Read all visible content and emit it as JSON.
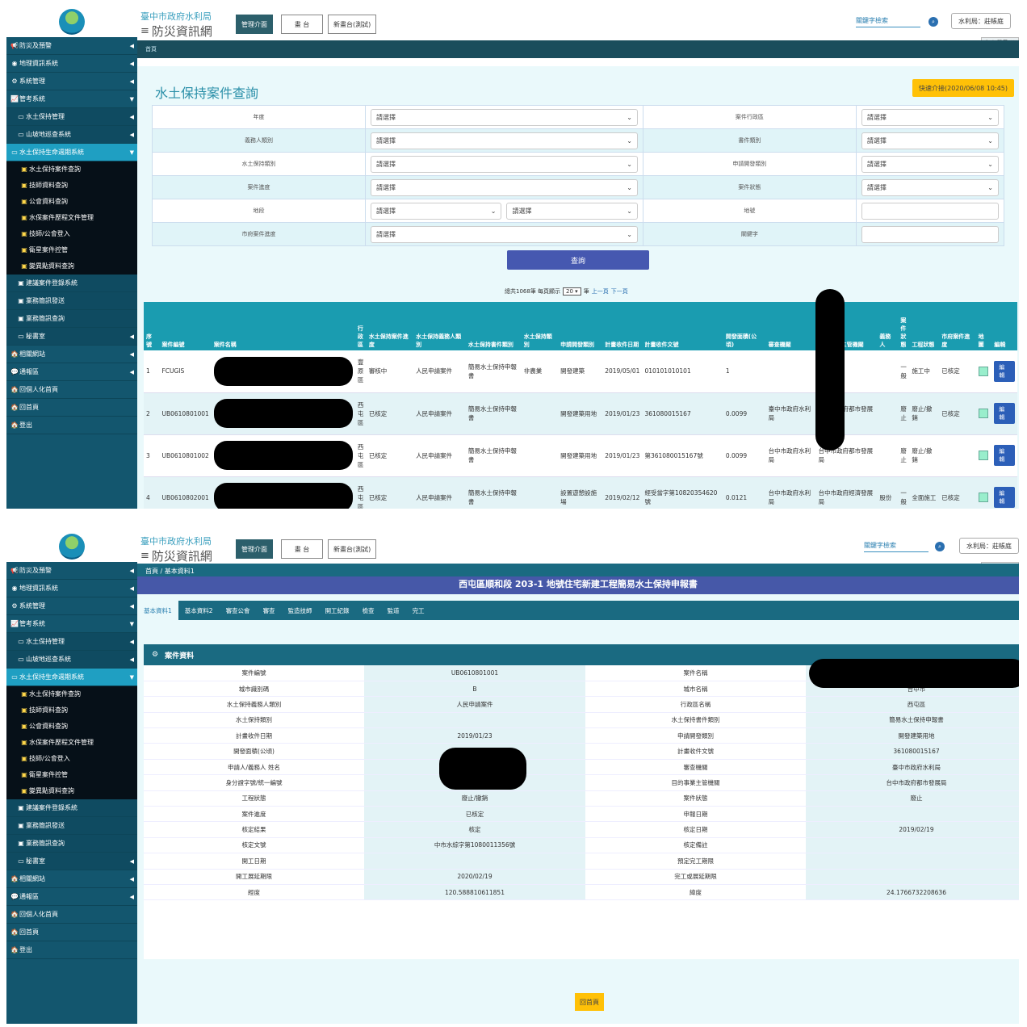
{
  "brand": {
    "agency": "臺中市政府水利局",
    "system": "防災資訊網"
  },
  "header": {
    "manage": "管理介面",
    "wall": "畫 台",
    "wall_test": "新畫台(測試)",
    "keyword": "關鍵字檢索",
    "user": "水利局：莊帳庭",
    "fav": "加入最愛 ♡"
  },
  "sidebar1": [
    {
      "icon": "📢",
      "label": "防災及預警",
      "arrow": "◀",
      "type": "plain"
    },
    {
      "icon": "◉",
      "label": "地理資訊系統",
      "arrow": "◀",
      "type": "plain"
    },
    {
      "icon": "⚙",
      "label": "系統管理",
      "arrow": "◀",
      "type": "plain"
    },
    {
      "icon": "📈",
      "label": "管考系統",
      "arrow": "▼",
      "type": "plain"
    },
    {
      "icon": "▭",
      "label": "水土保持管理",
      "arrow": "◀",
      "type": "sub"
    },
    {
      "icon": "▭",
      "label": "山坡地巡查系統",
      "arrow": "◀",
      "type": "sub"
    },
    {
      "icon": "▭",
      "label": "水土保持生命週期系統",
      "arrow": "▼",
      "type": "act"
    },
    {
      "icon": "▣",
      "label": "水土保持案件查詢",
      "arrow": "",
      "type": "leaf"
    },
    {
      "icon": "▣",
      "label": "技師資料查詢",
      "arrow": "",
      "type": "leaf"
    },
    {
      "icon": "▣",
      "label": "公會資料查詢",
      "arrow": "",
      "type": "leaf"
    },
    {
      "icon": "▣",
      "label": "水保案件歷程文件管理",
      "arrow": "",
      "type": "leaf"
    },
    {
      "icon": "▣",
      "label": "技師/公會登入",
      "arrow": "",
      "type": "leaf"
    },
    {
      "icon": "▣",
      "label": "衛星案件控管",
      "arrow": "",
      "type": "leaf"
    },
    {
      "icon": "▣",
      "label": "變異點資料查詢",
      "arrow": "",
      "type": "leaf"
    },
    {
      "icon": "▣",
      "label": "建議案件登錄系統",
      "arrow": "",
      "type": "sub"
    },
    {
      "icon": "▣",
      "label": "業務簡訊發送",
      "arrow": "",
      "type": "sub"
    },
    {
      "icon": "▣",
      "label": "業務簡訊查詢",
      "arrow": "",
      "type": "sub"
    },
    {
      "icon": "▭",
      "label": "秘書室",
      "arrow": "◀",
      "type": "sub"
    },
    {
      "icon": "🏠",
      "label": "相關網站",
      "arrow": "◀",
      "type": "plain"
    },
    {
      "icon": "💬",
      "label": "通報區",
      "arrow": "◀",
      "type": "plain"
    },
    {
      "icon": "🏠",
      "label": "回個人化首頁",
      "arrow": "",
      "type": "plain"
    },
    {
      "icon": "🏠",
      "label": "回首頁",
      "arrow": "",
      "type": "plain"
    },
    {
      "icon": "🏠",
      "label": "登出",
      "arrow": "",
      "type": "plain"
    }
  ],
  "screen1": {
    "breadcrumb": "首頁",
    "title": "水土保持案件查詢",
    "quick": "快速介接(2020/06/08 10:45)",
    "placeholder": "請選擇",
    "filters": [
      [
        "年度",
        "案件行政區"
      ],
      [
        "義務人類別",
        "書件類別"
      ],
      [
        "水土保持類別",
        "申請開發類別"
      ],
      [
        "案件進度",
        "案件狀態"
      ],
      [
        "地段",
        "地號"
      ],
      [
        "市府案件進度",
        "關鍵字"
      ]
    ],
    "query": "查詢",
    "pager": {
      "prefix": "總共1068筆 每頁顯示",
      "size": "20 ▾",
      "suffix": "筆",
      "prev": "上一頁",
      "next": "下一頁"
    },
    "columns": [
      "序號",
      "案件編號",
      "案件名稱",
      "行政區",
      "水土保持案件進度",
      "水土保持義務人類別",
      "水土保持書件類別",
      "水土保持類別",
      "申請開發類別",
      "計畫收件日期",
      "計畫收件文號",
      "開發面積(公頃)",
      "審查機關",
      "目的事業主管機關",
      "義務人",
      "案件狀態",
      "工程狀態",
      "市府案件進度",
      "地圖",
      "編輯"
    ],
    "rows": [
      [
        "1",
        "FCUGIS",
        "",
        "豐原區",
        "審核中",
        "人民申請案件",
        "簡易水土保持申報書",
        "非農業",
        "開發建築",
        "2019/05/01",
        "010101010101",
        "1",
        "",
        "",
        "",
        "一般",
        "施工中",
        "已核定",
        "",
        "編輯"
      ],
      [
        "2",
        "UB0610801001",
        "",
        "西屯區",
        "已核定",
        "人民申請案件",
        "簡易水土保持申報書",
        "",
        "開發建築用地",
        "2019/01/23",
        "361080015167",
        "0.0099",
        "臺中市政府水利局",
        "台中市政府都市發展局",
        "",
        "廢止",
        "廢止/撤銷",
        "已核定",
        "",
        "編輯"
      ],
      [
        "3",
        "UB0610801002",
        "",
        "西屯區",
        "已核定",
        "人民申請案件",
        "簡易水土保持申報書",
        "",
        "開發建築用地",
        "2019/01/23",
        "第361080015167號",
        "0.0099",
        "台中市政府水利局",
        "台中市政府都市發展局",
        "",
        "廢止",
        "廢止/撤銷",
        "",
        "",
        "編輯"
      ],
      [
        "4",
        "UB0610802001",
        "業",
        "西屯區",
        "已核定",
        "人民申請案件",
        "簡易水土保持申報書",
        "",
        "設置遊憩設施場",
        "2019/02/12",
        "經受當字第10820354620號",
        "0.0121",
        "台中市政府水利局",
        "台中市政府經濟發展局",
        "股份",
        "一般",
        "全面施工",
        "已核定",
        "",
        "編輯"
      ]
    ]
  },
  "screen2": {
    "breadcrumb": "首頁 / 基本資料1",
    "doc_title": "西屯區順和段 203-1 地號住宅新建工程簡易水土保持申報書",
    "tabs": [
      "基本資料1",
      "基本資料2",
      "審查公會",
      "審查",
      "監造技師",
      "開工紀錄",
      "檢查",
      "監道",
      "完工"
    ],
    "card_title": "案件資料",
    "info": [
      [
        "案件編號",
        "UB0610801001",
        "案件名稱",
        ""
      ],
      [
        "城市識別碼",
        "B",
        "城市名稱",
        "台中市"
      ],
      [
        "水土保持義務人類別",
        "人民申請案件",
        "行政區名稱",
        "西屯區"
      ],
      [
        "水土保持類別",
        "",
        "水土保持書件類別",
        "簡易水土保持申報書"
      ],
      [
        "計畫收件日期",
        "2019/01/23",
        "申請開發類別",
        "開發建築用地"
      ],
      [
        "開發面積(公頃)",
        "",
        "計畫收件文號",
        "361080015167"
      ],
      [
        "申請人/義務人 姓名",
        "",
        "審查機關",
        "臺中市政府水利局"
      ],
      [
        "身分證字號/統一編號",
        "",
        "目的事業主管機關",
        "台中市政府都市發展局"
      ],
      [
        "工程狀態",
        "廢止/撤銷",
        "案件狀態",
        "廢止"
      ],
      [
        "案件進度",
        "已核定",
        "申報日期",
        ""
      ],
      [
        "核定結果",
        "核定",
        "核定日期",
        "2019/02/19"
      ],
      [
        "核定文號",
        "中市水綜字第1080011356號",
        "核定備註",
        ""
      ],
      [
        "開工日期",
        "",
        "預定完工期限",
        ""
      ],
      [
        "開工展延期限",
        "2020/02/19",
        "完工或展延期限",
        ""
      ],
      [
        "經度",
        "120.588810611851",
        "緯度",
        "24.1766732208636"
      ]
    ],
    "back": "回首頁"
  }
}
